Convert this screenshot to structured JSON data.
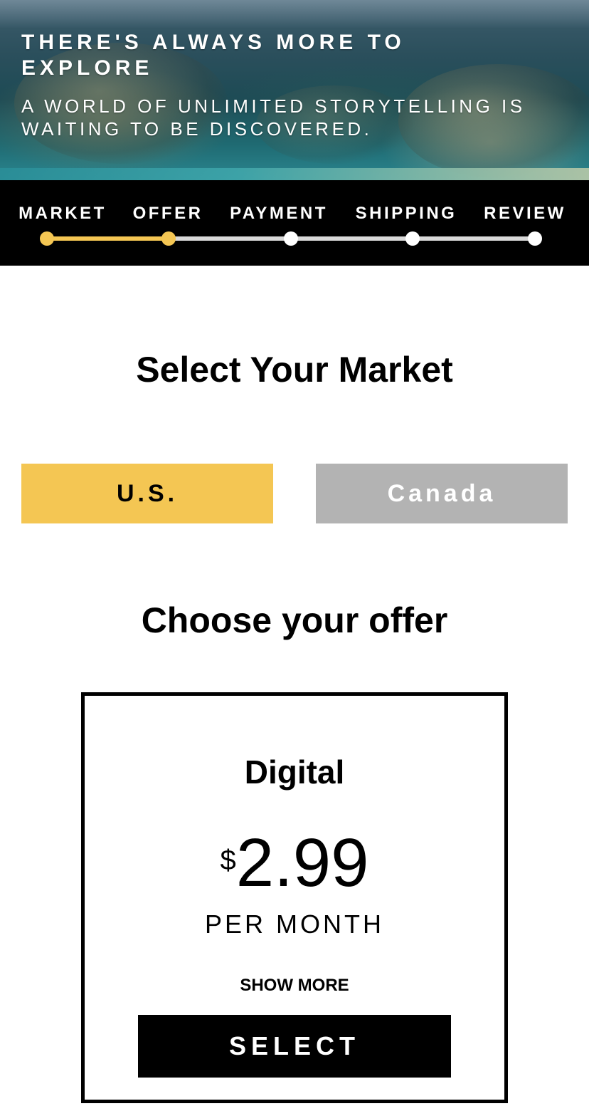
{
  "hero": {
    "title": "THERE'S ALWAYS MORE TO EXPLORE",
    "subtitle": "A WORLD OF UNLIMITED STORYTELLING IS WAITING TO BE DISCOVERED.",
    "image": "sea-turtles-underwater"
  },
  "stepper": {
    "steps": [
      {
        "label": "MARKET",
        "done": true
      },
      {
        "label": "OFFER",
        "done": true
      },
      {
        "label": "PAYMENT",
        "done": false
      },
      {
        "label": "SHIPPING",
        "done": false
      },
      {
        "label": "REVIEW",
        "done": false
      }
    ],
    "progress": 0.25,
    "active_color": "#f4c653",
    "inactive_color": "#ffffff"
  },
  "market": {
    "heading": "Select Your Market",
    "options": [
      {
        "label": "U.S.",
        "selected": true,
        "color": "#f4c653"
      },
      {
        "label": "Canada",
        "selected": false,
        "color": "#b3b3b3"
      }
    ]
  },
  "offer": {
    "heading": "Choose your offer",
    "card": {
      "name": "Digital",
      "currency": "$",
      "price": "2.99",
      "period": "PER MONTH",
      "show_more": "SHOW MORE",
      "select_label": "SELECT"
    }
  }
}
